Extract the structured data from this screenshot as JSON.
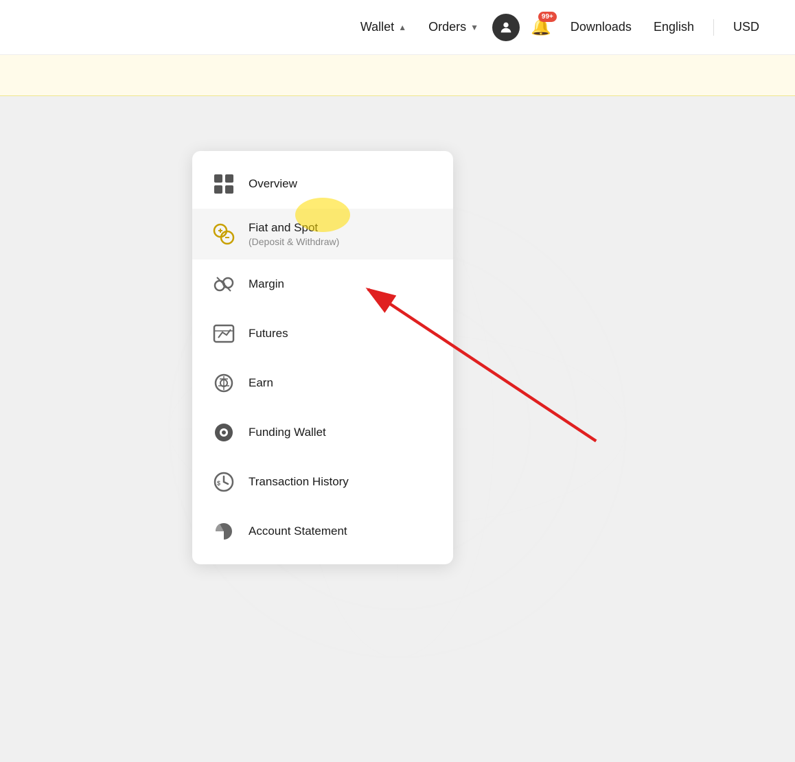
{
  "navbar": {
    "wallet_label": "Wallet",
    "orders_label": "Orders",
    "downloads_label": "Downloads",
    "english_label": "English",
    "usd_label": "USD",
    "notification_count": "99+"
  },
  "dropdown": {
    "items": [
      {
        "id": "overview",
        "label": "Overview",
        "sublabel": "",
        "icon": "grid"
      },
      {
        "id": "fiat-spot",
        "label": "Fiat and Spot",
        "sublabel": "(Deposit & Withdraw)",
        "icon": "fiat"
      },
      {
        "id": "margin",
        "label": "Margin",
        "sublabel": "",
        "icon": "margin"
      },
      {
        "id": "futures",
        "label": "Futures",
        "sublabel": "",
        "icon": "futures"
      },
      {
        "id": "earn",
        "label": "Earn",
        "sublabel": "",
        "icon": "earn"
      },
      {
        "id": "funding-wallet",
        "label": "Funding Wallet",
        "sublabel": "",
        "icon": "funding"
      },
      {
        "id": "transaction-history",
        "label": "Transaction History",
        "sublabel": "",
        "icon": "transaction"
      },
      {
        "id": "account-statement",
        "label": "Account Statement",
        "sublabel": "",
        "icon": "statement"
      }
    ]
  }
}
